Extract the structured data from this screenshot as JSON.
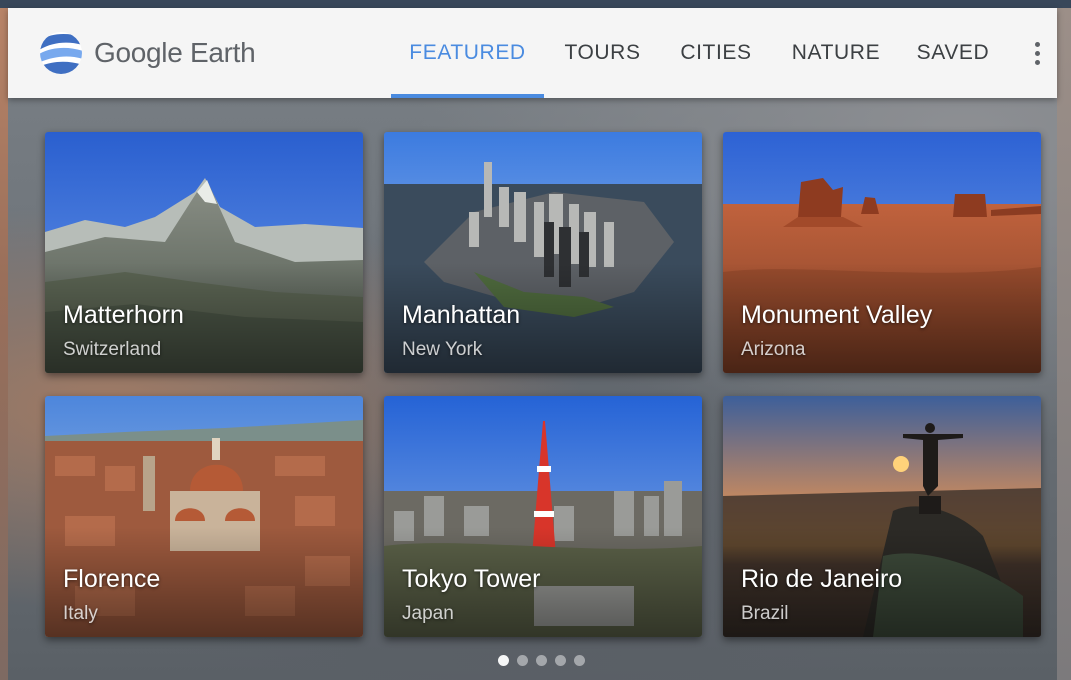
{
  "app": {
    "name": "Google Earth",
    "brand_colors": {
      "blue_light": "#78a9ee",
      "blue_dark": "#3f6fc2",
      "accent": "#4a8be0"
    }
  },
  "nav": {
    "tabs": [
      {
        "label": "FEATURED",
        "active": true
      },
      {
        "label": "TOURS",
        "active": false
      },
      {
        "label": "CITIES",
        "active": false
      },
      {
        "label": "NATURE",
        "active": false
      },
      {
        "label": "SAVED",
        "active": false
      }
    ],
    "more_icon": "more-vert-icon"
  },
  "cards": [
    {
      "title": "Matterhorn",
      "subtitle": "Switzerland"
    },
    {
      "title": "Manhattan",
      "subtitle": "New York"
    },
    {
      "title": "Monument Valley",
      "subtitle": "Arizona"
    },
    {
      "title": "Florence",
      "subtitle": "Italy"
    },
    {
      "title": "Tokyo Tower",
      "subtitle": "Japan"
    },
    {
      "title": "Rio de Janeiro",
      "subtitle": "Brazil"
    }
  ],
  "pagination": {
    "pages": 5,
    "current": 1
  }
}
